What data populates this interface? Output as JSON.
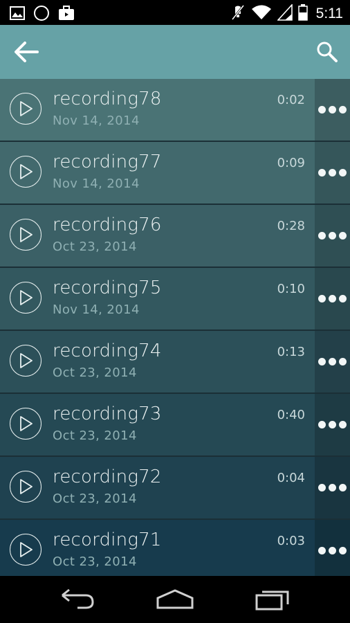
{
  "status_bar": {
    "time": "5:11",
    "left_icons": [
      "image-icon",
      "circle-icon",
      "briefcase-icon"
    ],
    "right_icons": [
      "mute-icon",
      "wifi-icon",
      "signal-icon",
      "battery-icon"
    ]
  },
  "app_bar": {
    "back_icon": "arrow-left-icon",
    "search_icon": "search-icon",
    "background": "#66a2a6"
  },
  "recordings": [
    {
      "name": "recording78",
      "date": "Nov 14, 2014",
      "duration": "0:02",
      "bg": "#4a7375",
      "more_bg": "#3c5d60"
    },
    {
      "name": "recording77",
      "date": "Nov 14, 2014",
      "duration": "0:09",
      "bg": "#42696d",
      "more_bg": "#35565a"
    },
    {
      "name": "recording76",
      "date": "Oct 23, 2014",
      "duration": "0:28",
      "bg": "#3b6066",
      "more_bg": "#2f4f54"
    },
    {
      "name": "recording75",
      "date": "Nov 14, 2014",
      "duration": "0:10",
      "bg": "#33585f",
      "more_bg": "#29484e"
    },
    {
      "name": "recording74",
      "date": "Oct 23, 2014",
      "duration": "0:13",
      "bg": "#2c5059",
      "more_bg": "#234049"
    },
    {
      "name": "recording73",
      "date": "Oct 23, 2014",
      "duration": "0:40",
      "bg": "#254954",
      "more_bg": "#1e3b44"
    },
    {
      "name": "recording72",
      "date": "Oct 23, 2014",
      "duration": "0:04",
      "bg": "#1f4250",
      "more_bg": "#193540"
    },
    {
      "name": "recording71",
      "date": "Oct 23, 2014",
      "duration": "0:03",
      "bg": "#173b4d",
      "more_bg": "#12303d"
    }
  ],
  "nav_bar": {
    "back_icon": "nav-back-icon",
    "home_icon": "nav-home-icon",
    "recents_icon": "nav-recents-icon"
  }
}
